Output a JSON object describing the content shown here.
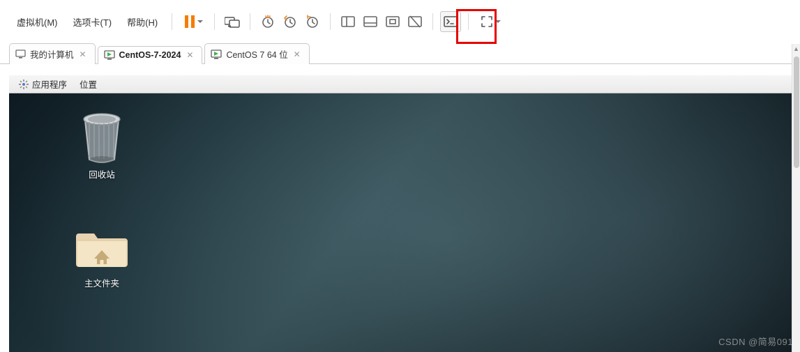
{
  "menu": {
    "vm": "虚拟机(M)",
    "tabs": "选项卡(T)",
    "help": "帮助(H)"
  },
  "toolbar": {
    "icons": {
      "pause": "pause-icon",
      "send": "send-icon",
      "snap_clock": "snapshot-clock-icon",
      "snap_revert": "snapshot-revert-icon",
      "snap_manage": "snapshot-manage-icon",
      "view_thumb": "view-thumbnail-icon",
      "view_single": "view-single-icon",
      "view_unity": "view-unity-icon",
      "view_no": "view-disable-icon",
      "console": "console-icon",
      "fullscreen": "fullscreen-icon"
    }
  },
  "tabs": [
    {
      "label": "我的计算机",
      "icon": "monitor-icon",
      "active": false
    },
    {
      "label": "CentOS-7-2024",
      "icon": "vm-running-icon",
      "active": true
    },
    {
      "label": "CentOS 7 64 位",
      "icon": "vm-running-icon",
      "active": false
    }
  ],
  "guest_menubar": {
    "applications": "应用程序",
    "places": "位置"
  },
  "desktop_icons": {
    "trash": "回收站",
    "home": "主文件夹"
  },
  "watermark": "CSDN @简易091"
}
